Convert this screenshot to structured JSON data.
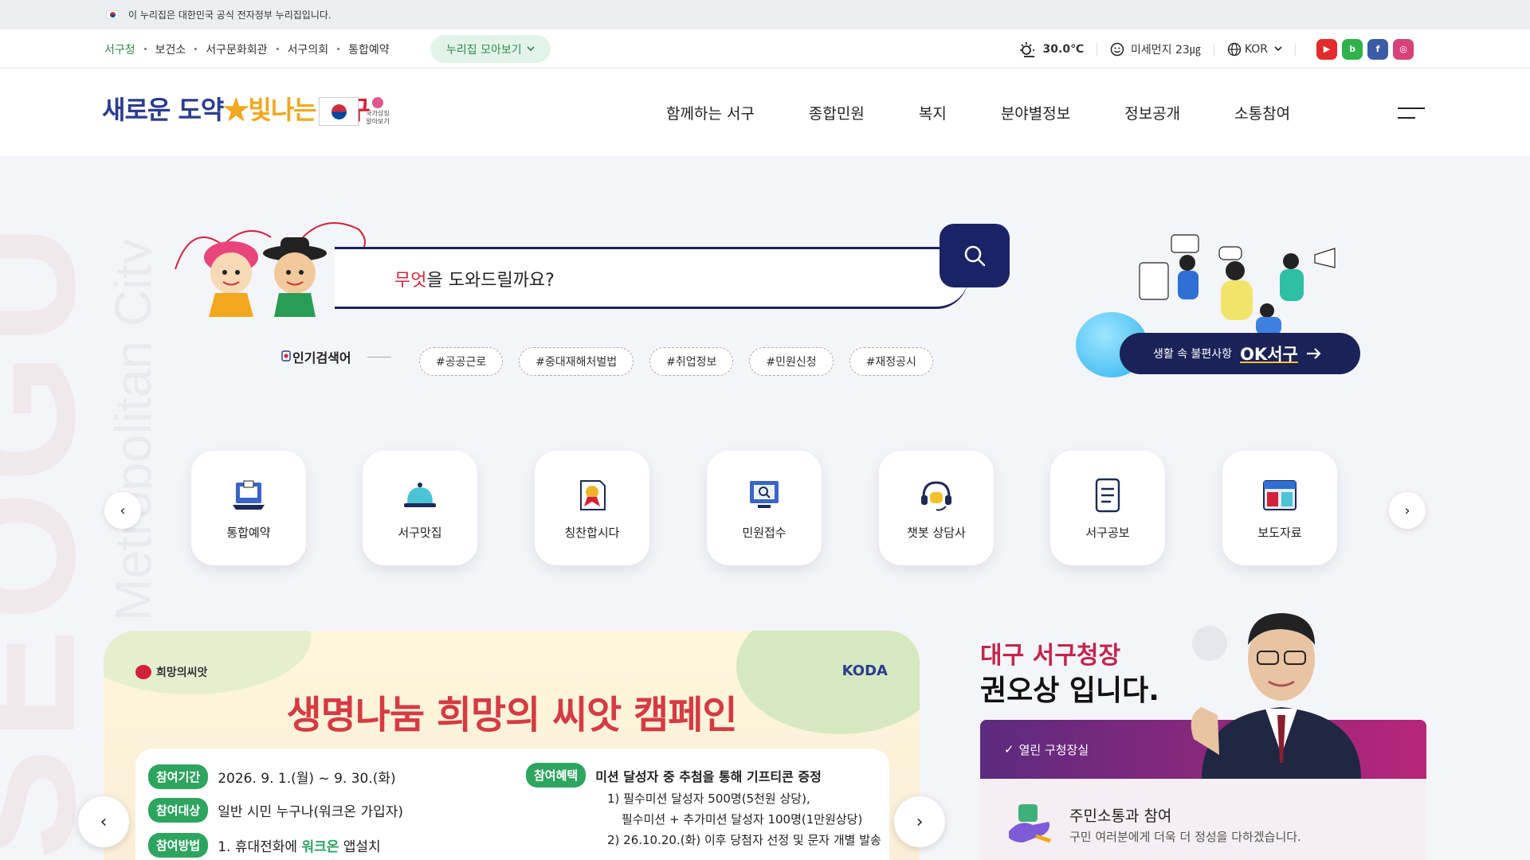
{
  "gov_banner": {
    "text": "이 누리집은 대한민국 공식 전자정부 누리집입니다."
  },
  "util": {
    "links": [
      "서구청",
      "보건소",
      "서구문화회관",
      "서구의회",
      "통합예약"
    ],
    "nuri_button": "누리집 모아보기",
    "temperature": "30.0℃",
    "dust": "미세먼지 23㎍",
    "language": "KOR",
    "sns": [
      "youtube",
      "blog",
      "facebook",
      "instagram"
    ],
    "sns_colors": [
      "#e32b2b",
      "#2fb24b",
      "#3b5ba7",
      "#d7427a"
    ]
  },
  "header": {
    "logo": {
      "part1": "새로운 ",
      "part2": "도약",
      "part3": "빛나는 ",
      "part4": "서구"
    },
    "national_symbol_label": "국가상징 알아보기",
    "nav": [
      "함께하는 서구",
      "종합민원",
      "복지",
      "분야별정보",
      "정보공개",
      "소통참여"
    ]
  },
  "watermark": {
    "big": "SEOGU",
    "small": "Metropolitan City"
  },
  "search": {
    "label_highlight": "무엇",
    "label_rest": "을 도와드릴까요?",
    "popular_label": "인기검색어",
    "tags": [
      "#공공근로",
      "#중대재해처벌법",
      "#취업정보",
      "#민원신청",
      "#재정공시"
    ]
  },
  "ok_seogu": {
    "prefix": "생활 속 불편사항",
    "name": "OK서구"
  },
  "quick_menu": [
    {
      "label": "통합예약",
      "icon": "laptop-icon"
    },
    {
      "label": "서구맛집",
      "icon": "cloche-icon"
    },
    {
      "label": "칭찬합시다",
      "icon": "award-icon"
    },
    {
      "label": "민원접수",
      "icon": "monitor-search-icon"
    },
    {
      "label": "챗봇 상담사",
      "icon": "headset-icon"
    },
    {
      "label": "서구공보",
      "icon": "document-icon"
    },
    {
      "label": "보도자료",
      "icon": "press-icon"
    }
  ],
  "campaign": {
    "org_logo": "희망의씨앗",
    "partner_logo": "KODA",
    "title": "생명나눔 희망의 씨앗 캠페인",
    "period_label": "참여기간",
    "period": "2026. 9. 1.(월) ~ 9. 30.(화)",
    "target_label": "참여대상",
    "target": "일반 시민 누구나(워크온 가입자)",
    "method_label": "참여방법",
    "method_prefix": "1. 휴대전화에 ",
    "method_highlight": "워크온",
    "method_suffix": " 앱설치",
    "benefit_label": "참여혜택",
    "benefit_title": "미션 달성자 중 추첨을 통해 기프티콘 증정",
    "benefit_lines": [
      "1) 필수미션 달성자 500명(5천원 상당),",
      "필수미션 + 추가미션 달성자 100명(1만원상당)",
      "2) 26.10.20.(화) 이후 당첨자 선정 및 문자 개별 발송"
    ]
  },
  "mayor": {
    "title1": "대구 서구청장",
    "title2": "권오상 입니다.",
    "panel_label": "열린 구청장실",
    "sub_title": "주민소통과 참여",
    "sub_text": "구민 여러분에게 더욱 더 정성을 다하겠습니다."
  }
}
